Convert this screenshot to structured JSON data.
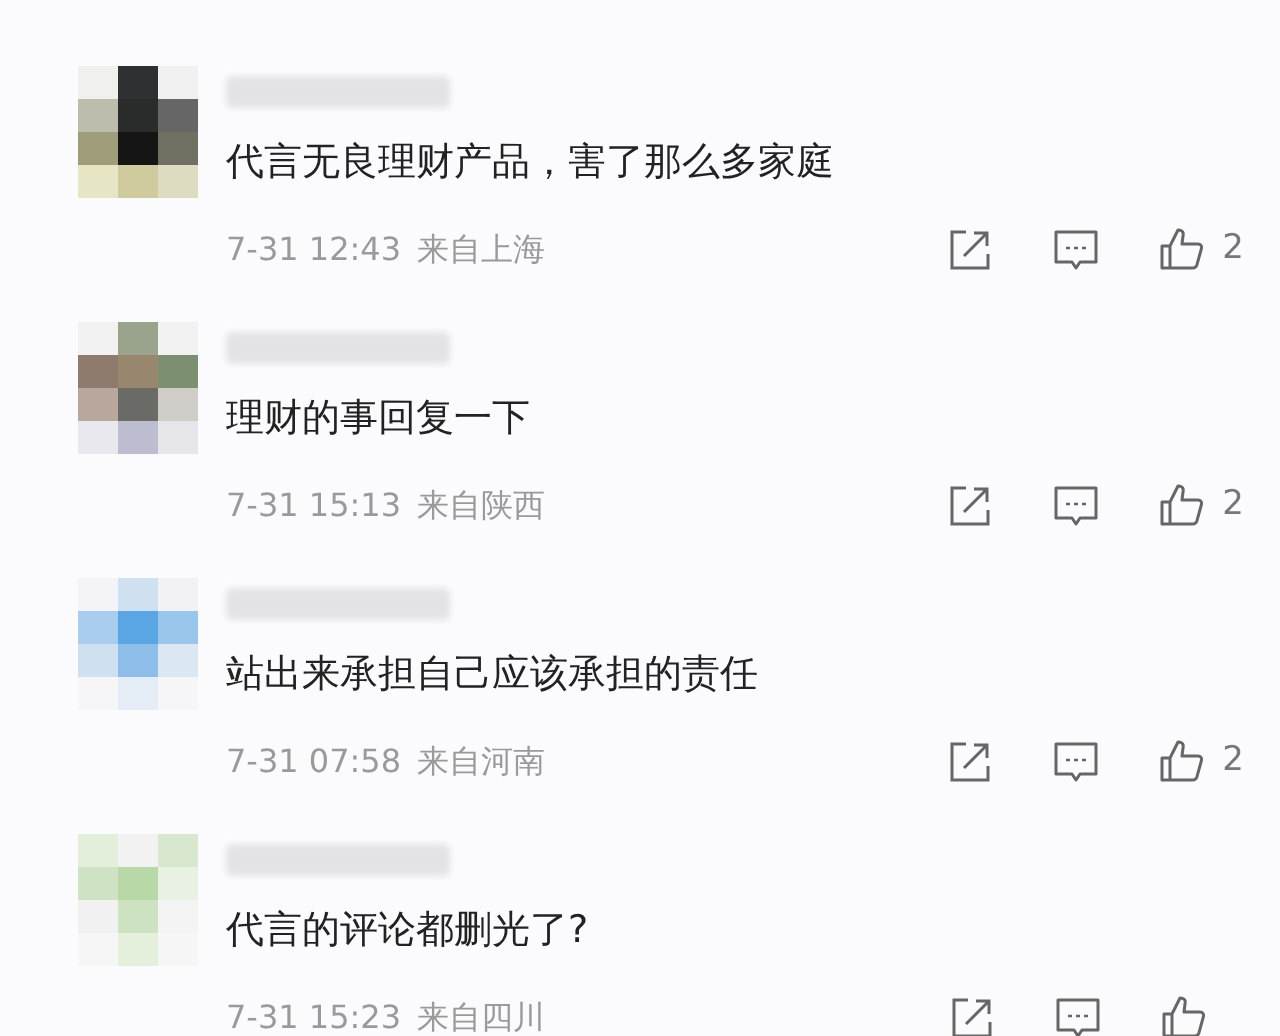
{
  "comments": [
    {
      "text": "代言无良理财产品，害了那么多家庭",
      "time": "7-31 12:43",
      "location": "来自上海",
      "likes": "2"
    },
    {
      "text": "理财的事回复一下",
      "time": "7-31 15:13",
      "location": "来自陕西",
      "likes": "2"
    },
    {
      "text": "站出来承担自己应该承担的责任",
      "time": "7-31 07:58",
      "location": "来自河南",
      "likes": "2"
    },
    {
      "text": "代言的评论都删光了?",
      "time": "7-31 15:23",
      "location": "来自四川"
    }
  ]
}
